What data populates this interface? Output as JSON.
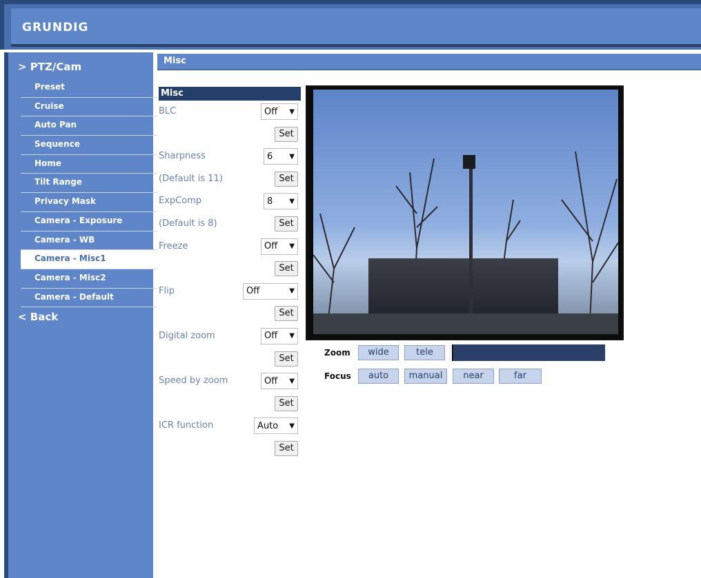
{
  "header": {
    "logo": "GRUNDIG"
  },
  "sidebar": {
    "section": "> PTZ/Cam",
    "items": [
      "Preset",
      "Cruise",
      "Auto Pan",
      "Sequence",
      "Home",
      "Tilt Range",
      "Privacy Mask",
      "Camera - Exposure",
      "Camera - WB",
      "Camera - Misc1",
      "Camera - Misc2",
      "Camera - Default"
    ],
    "active_item": "Camera - Misc1",
    "back": "< Back"
  },
  "main": {
    "title": "Misc"
  },
  "panel": {
    "header": "Misc",
    "set_label": "Set",
    "settings": [
      {
        "label": "BLC",
        "value": "Off"
      },
      {
        "label": "Sharpness",
        "value": "6",
        "note": "(Default is 11)"
      },
      {
        "label": "ExpComp",
        "value": "8",
        "note": "(Default is 8)"
      },
      {
        "label": "Freeze",
        "value": "Off"
      },
      {
        "label": "Flip",
        "value": "Off"
      },
      {
        "label": "Digital zoom",
        "value": "Off"
      },
      {
        "label": "Speed by zoom",
        "value": "Off"
      },
      {
        "label": "ICR function",
        "value": "Auto"
      }
    ]
  },
  "controls": {
    "zoom_label": "Zoom",
    "focus_label": "Focus",
    "zoom_buttons": [
      "wide",
      "tele"
    ],
    "focus_buttons": [
      "auto",
      "manual",
      "near",
      "far"
    ]
  },
  "icons": {
    "dropdown": "chevron-down-icon"
  },
  "colors": {
    "header": "#5f86c8",
    "sidebar": "#5f86c8",
    "panel_header": "#253f6b",
    "label": "#6b83ad"
  }
}
